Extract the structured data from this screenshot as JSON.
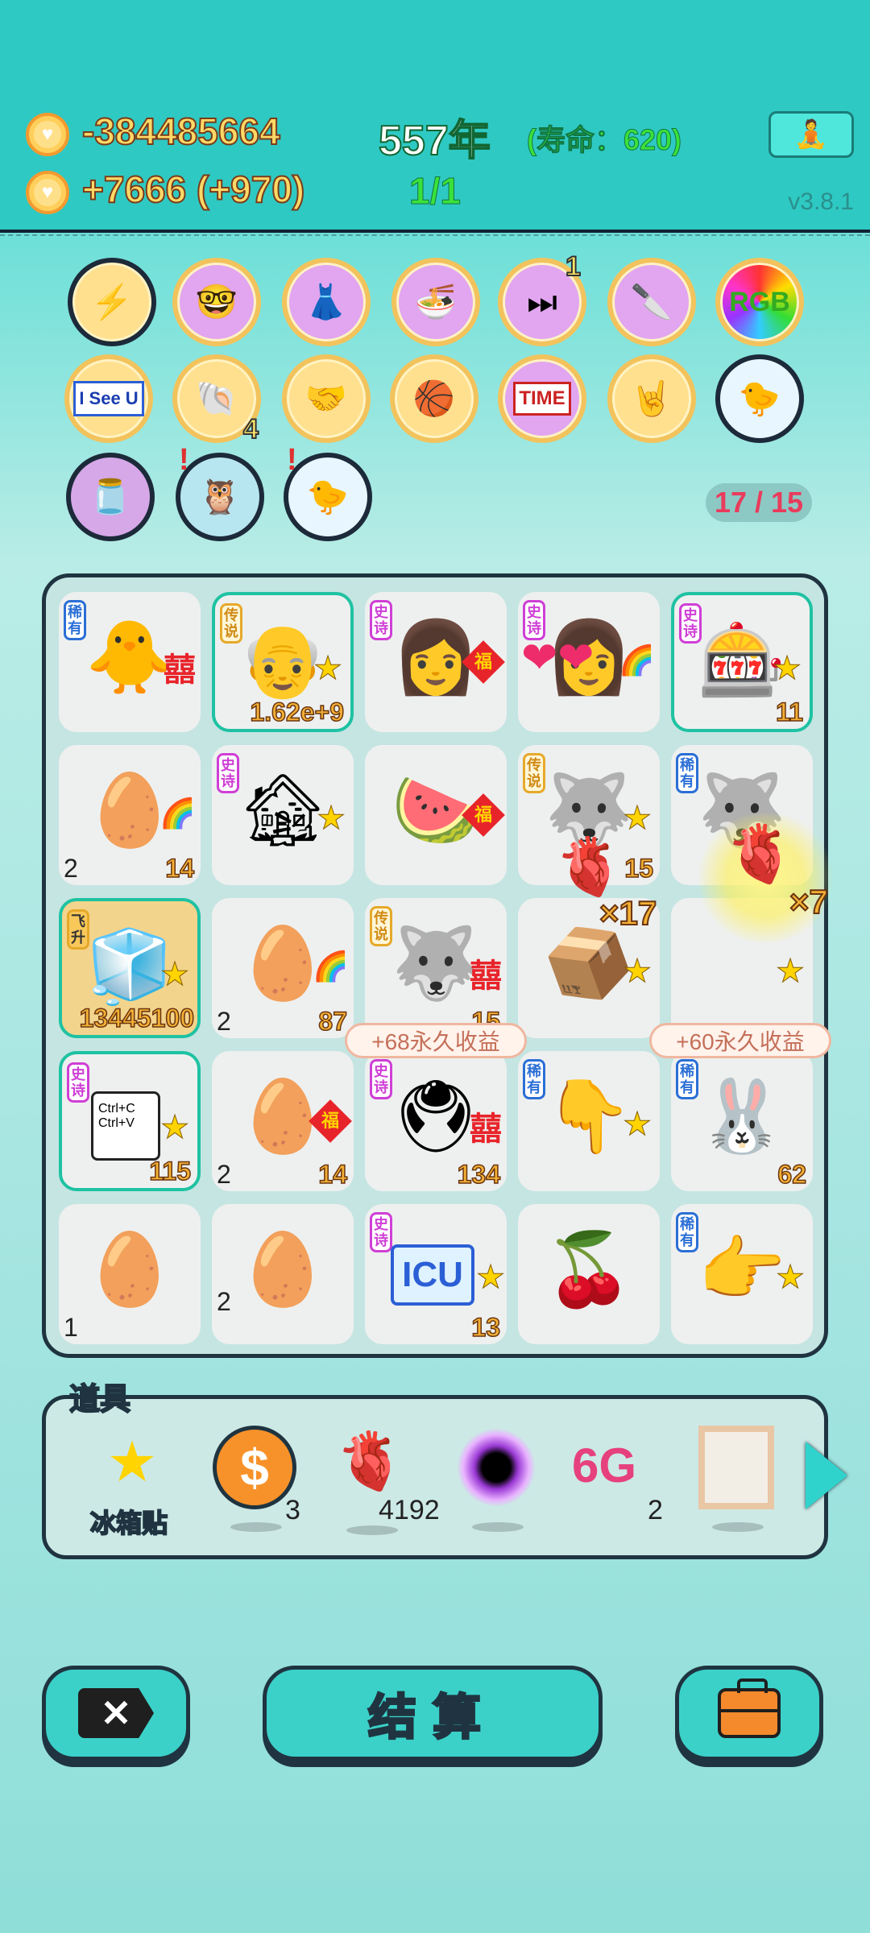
{
  "header": {
    "money_total": "-384485664",
    "money_rate": "+7666 (+970)",
    "year": "557年",
    "lifespan": "(寿命：620)",
    "stage": "1/1",
    "version": "v3.8.1"
  },
  "badges": {
    "count_skip": "1",
    "count_shell": "4",
    "slots": "17 / 15",
    "rgb_label": "RGB",
    "iseeu_label": "I See U",
    "time_label": "TIME"
  },
  "board": {
    "r1c1_rarity": "稀有",
    "r1c1_tag": "囍",
    "r1c2_rarity": "传说",
    "r1c2_num": "1.62e+9",
    "r1c3_rarity": "史诗",
    "r1c3_tag": "福",
    "r1c4_rarity": "史诗",
    "r1c5_rarity": "史诗",
    "r1c5_num": "11",
    "r2c1_left": "2",
    "r2c1_num": "14",
    "r2c2_rarity": "史诗",
    "r2c3_tag": "福",
    "r2c4_rarity": "传说",
    "r2c4_num": "15",
    "r2c5_rarity": "稀有",
    "r3c1_rarity": "飞升",
    "r3c1_num": "13445100",
    "r3c2_left": "2",
    "r3c2_num": "87",
    "r3c3_rarity": "传说",
    "r3c3_tag": "囍",
    "r3c3_num": "15",
    "r4c1_rarity": "史诗",
    "r4c1_num": "115",
    "r4c1_text": "Ctrl+C Ctrl+V",
    "r4c2_left": "2",
    "r4c2_num": "14",
    "r4c2_tag": "福",
    "r4c3_rarity": "史诗",
    "r4c3_tag": "囍",
    "r4c3_num": "134",
    "r4c4_rarity": "稀有",
    "r4c5_rarity": "稀有",
    "r4c5_num": "62",
    "r5c1_left": "1",
    "r5c2_left": "2",
    "r5c3_rarity": "史诗",
    "r5c3_text": "ICU",
    "r5c3_num": "13",
    "r5c5_rarity": "稀有",
    "bubble_left": "+68永久收益",
    "bubble_right": "+60永久收益",
    "mult_a": "×17",
    "mult_b": "×7"
  },
  "props": {
    "title": "道具",
    "star_label": "冰箱贴",
    "coin_count": "3",
    "liver_count": "4192",
    "g6_label": "6G",
    "g6_count": "2"
  },
  "buttons": {
    "settle": "结算"
  }
}
